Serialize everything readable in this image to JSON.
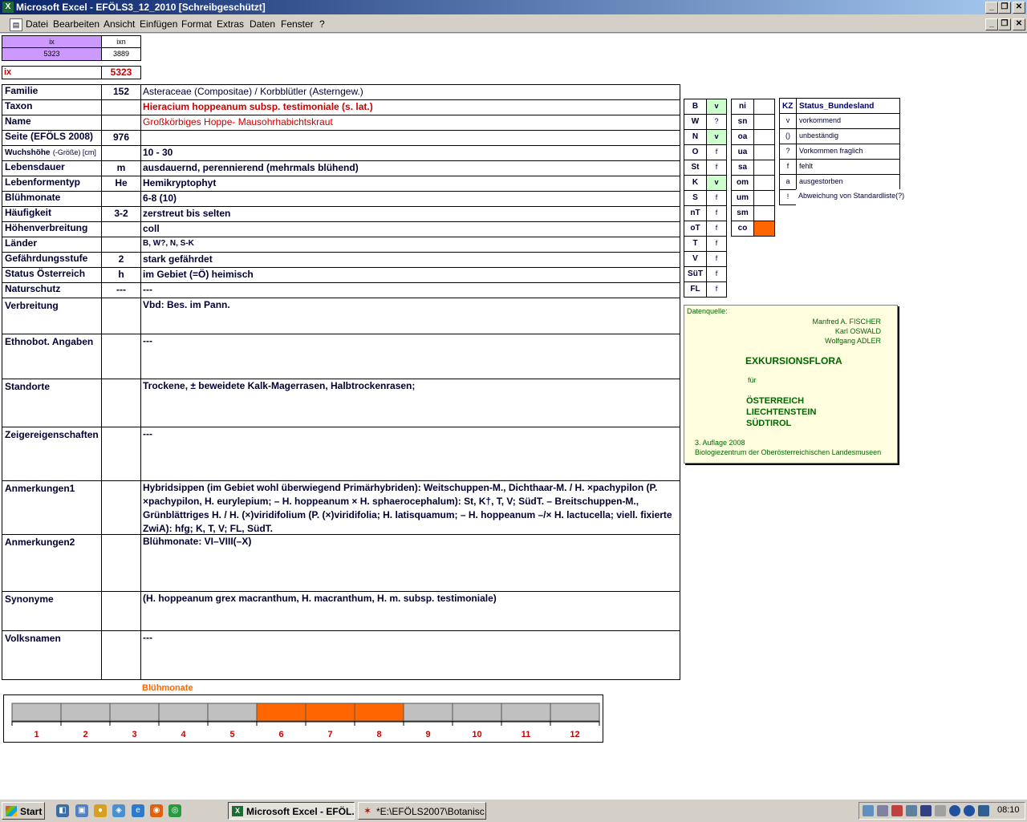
{
  "window": {
    "title": "Microsoft Excel - EFÖLS3_12_2010  [Schreibgeschützt]",
    "min": "_",
    "max": "❐",
    "close": "✕"
  },
  "menu": [
    "Datei",
    "Bearbeiten",
    "Ansicht",
    "Einfügen",
    "Format",
    "Extras",
    "Daten",
    "Fenster",
    "?"
  ],
  "index": {
    "ix_header": "ix",
    "ixn_header": "ixn",
    "ix_value": "5323",
    "ixn_value": "3889",
    "ix_label": "ix",
    "ix_current": "5323"
  },
  "rows": [
    {
      "label": "Familie",
      "code": "152",
      "value": "Asteraceae (Compositae)  /  Korbblütler (Asterngew.)"
    },
    {
      "label": "Taxon",
      "code": "",
      "value": "Hieracium hoppeanum subsp. testimoniale (s. lat.)"
    },
    {
      "label": "Name",
      "code": "",
      "value": "Großkörbiges Hoppe- Mausohrhabichtskraut"
    },
    {
      "label": "Seite (EFÖLS 2008)",
      "code": "976",
      "value": ""
    },
    {
      "label": "Wuchshöhe",
      "label_suffix": "(-Größe) [cm]",
      "code": "",
      "value": " 10 - 30"
    },
    {
      "label": "Lebensdauer",
      "code": "m",
      "value": "ausdauernd, perennierend (mehrmals blühend)"
    },
    {
      "label": "Lebenformentyp",
      "code": "He",
      "value": "Hemikryptophyt"
    },
    {
      "label": "Blühmonate",
      "code": "",
      "value": " 6-8 (10)"
    },
    {
      "label": "Häufigkeit",
      "code": "3-2",
      "value": "zerstreut bis selten"
    },
    {
      "label": "Höhenverbreitung",
      "code": "",
      "value": "coll"
    },
    {
      "label": "Länder",
      "code": "",
      "value": "B, W?, N, S-K"
    },
    {
      "label": "Gefährdungsstufe",
      "code": "2",
      "value": "stark gefährdet"
    },
    {
      "label": "Status Österreich",
      "code": "h",
      "value": "im Gebiet (=Ö) heimisch"
    },
    {
      "label": "Naturschutz",
      "code": "---",
      "value": " ---"
    }
  ],
  "big_rows": [
    {
      "label": "Verbreitung",
      "value": "Vbd: Bes. im Pann."
    },
    {
      "label": "Ethnobot. Angaben",
      "value": "---"
    },
    {
      "label": "Standorte",
      "value": "Trockene, ± beweidete Kalk-Magerrasen, Halbtrockenrasen;"
    },
    {
      "label": "Zeigereigenschaften",
      "value": "---"
    },
    {
      "label": "Anmerkungen1",
      "value": "Hybridsippen (im Gebiet wohl überwiegend Primärhybriden): Weitschuppen-M., Dichthaar-M. / H. ×pachypilon (P. ×pachypilon, H. eurylepium; – H. hoppeanum × H. sphaerocephalum): St, K†, T, V; SüdT. – Breitschuppen-M., Grünblättriges H. / H. (×)viridifolium (P. (×)viridifolia; H. latisquamum; – H. hoppeanum –/× H. lactucella; viell. fixierte ZwiA): hfg; K, T, V; FL, SüdT."
    },
    {
      "label": "Anmerkungen2",
      "value": "Blühmonate: VI–VIII(–X)"
    },
    {
      "label": "Synonyme",
      "value": "(H. hoppeanum grex macranthum, H. macranthum, H. m. subsp. testimoniale)"
    },
    {
      "label": "Volksnamen",
      "value": "---"
    }
  ],
  "states": [
    {
      "code": "B",
      "status": "v"
    },
    {
      "code": "W",
      "status": "?"
    },
    {
      "code": "N",
      "status": "v"
    },
    {
      "code": "O",
      "status": "f"
    },
    {
      "code": "St",
      "status": "f"
    },
    {
      "code": "K",
      "status": "v"
    },
    {
      "code": "S",
      "status": "f"
    },
    {
      "code": "nT",
      "status": "f"
    },
    {
      "code": "oT",
      "status": "f"
    },
    {
      "code": "T",
      "status": "f"
    },
    {
      "code": "V",
      "status": "f"
    },
    {
      "code": "SüT",
      "status": "f"
    },
    {
      "code": "FL",
      "status": "f"
    }
  ],
  "altitude": [
    "ni",
    "sn",
    "oa",
    "ua",
    "sa",
    "om",
    "um",
    "sm",
    "co"
  ],
  "altitude_highlight": "co",
  "legend": {
    "header_kz": "KZ",
    "header_status": "Status_Bundesland",
    "items": [
      {
        "kz": "v",
        "text": "vorkommend"
      },
      {
        "kz": "()",
        "text": "unbeständig"
      },
      {
        "kz": "?",
        "text": "Vorkommen fraglich"
      },
      {
        "kz": "f",
        "text": "fehlt"
      },
      {
        "kz": "a",
        "text": "ausgestorben"
      },
      {
        "kz": "!",
        "text": "Abweichung von Standardliste(?)"
      }
    ]
  },
  "source": {
    "label": "Datenquelle:",
    "authors": [
      "Manfred A. FISCHER",
      "Karl OSWALD",
      "Wolfgang ADLER"
    ],
    "title": "EXKURSIONSFLORA",
    "fuer": "für",
    "countries": [
      "ÖSTERREICH",
      "LIECHTENSTEIN",
      "SÜDTIROL"
    ],
    "edition": "3. Auflage 2008",
    "publisher": "Biologiezentrum der Oberösterreichischen Landesmuseen"
  },
  "bloom_chart": {
    "title": "Blühmonate",
    "months": [
      "1",
      "2",
      "3",
      "4",
      "5",
      "6",
      "7",
      "8",
      "9",
      "10",
      "11",
      "12"
    ],
    "active": [
      6,
      7,
      8
    ],
    "active_color": "#ff6600",
    "inactive_color": "#c0c0c0"
  },
  "taskbar": {
    "start": "Start",
    "tasks": [
      "Microsoft Excel - EFÖL...",
      "*E:\\EFÖLS2007\\Botanisc..."
    ],
    "time": "08:10"
  },
  "colors": {
    "highlight_purple": "#cc99ff",
    "green_cell": "#ccffcc",
    "orange": "#ff6600",
    "source_bg": "#ffffe0",
    "dark_green": "#006600"
  }
}
